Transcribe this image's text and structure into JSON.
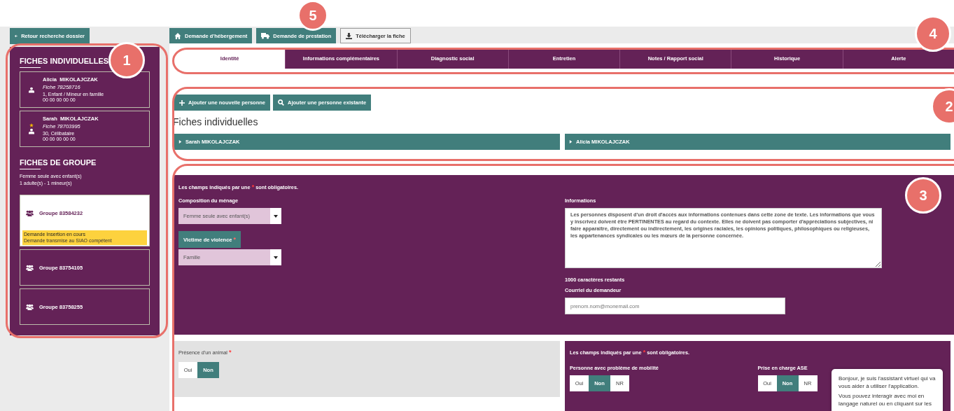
{
  "toolbar": {
    "back_button": {
      "label": "Retour recherche dossier"
    },
    "actions": [
      {
        "label": "Demande d'hébergement",
        "kind": "primary"
      },
      {
        "label": "Demande de prestation",
        "kind": "primary"
      },
      {
        "label": "Télécharger la fiche",
        "kind": "secondary"
      }
    ]
  },
  "sidebar": {
    "individual_title": "FICHES INDIVIDUELLES",
    "individuals": [
      {
        "first_name": "Alicia",
        "last_name": "MIKOLAJCZAK",
        "fiche": "Fiche 78258716",
        "detail": "1, Enfant / Mineur en famille",
        "phone": "00 00 00 00 00",
        "referent": false
      },
      {
        "first_name": "Sarah",
        "last_name": "MIKOLAJCZAK",
        "fiche": "Fiche 78703995",
        "detail": "30, Célibataire",
        "phone": "00 00 00 00 00",
        "referent": true
      }
    ],
    "group_title": "FICHES DE GROUPE",
    "group_composition": "Femme seule avec enfant(s)",
    "group_counts": "1 adulte(s) - 1 mineur(s)",
    "groups": [
      {
        "label": "Groupe 83584232",
        "selected": true,
        "status": [
          "Demande Insertion en cours",
          "Demande transmise au SIAO compétent"
        ]
      },
      {
        "label": "Groupe 83754105",
        "selected": false
      },
      {
        "label": "Groupe 83758255",
        "selected": false
      }
    ]
  },
  "tabs": [
    {
      "label": "Identité",
      "selected": true
    },
    {
      "label": "Informations complémentaires",
      "selected": false
    },
    {
      "label": "Diagnostic social",
      "selected": false
    },
    {
      "label": "Entretien",
      "selected": false
    },
    {
      "label": "Notes / Rapport social",
      "selected": false
    },
    {
      "label": "Historique",
      "selected": false
    },
    {
      "label": "Alerte",
      "selected": false
    }
  ],
  "person_buttons": [
    {
      "label": "Ajouter une nouvelle personne"
    },
    {
      "label": "Ajouter une personne existante"
    }
  ],
  "section_title": "Fiches individuelles",
  "persons": [
    {
      "label": "Sarah MIKOLAJCZAK",
      "expanded": false
    },
    {
      "label": "Alicia MIKOLAJCZAK",
      "expanded": false
    }
  ],
  "form": {
    "required_note": {
      "before": "Les champs indiqués par une",
      "mark": "*",
      "after": "sont obligatoires."
    },
    "composition": {
      "label": "Composition du ménage",
      "value": "Femme seule avec enfant(s)"
    },
    "violence": {
      "label": "Victime de violence",
      "mark": "*",
      "value": "Famille"
    },
    "informations": {
      "label": "Informations",
      "value": "Les personnes disposent d'un droit d'accès aux informations contenues dans cette zone de texte. Les informations que vous y inscrivez doivent être PERTINENTES au regard du contexte. Elles ne doivent pas comporter d'appréciations subjectives, ni faire apparaître, directement ou indirectement, les origines raciales, les opinions politiques, philosophiques ou religieuses, les appartenances syndicales ou les mœurs de la personne concernée.",
      "counter": "1000 caractères restants"
    },
    "email": {
      "label": "Courriel du demandeur",
      "placeholder": "prenom.nom@monemail.com"
    }
  },
  "animal": {
    "label": "Présence d'un animal",
    "mark": "*",
    "options": [
      {
        "label": "Oui",
        "selected": false
      },
      {
        "label": "Non",
        "selected": true
      }
    ]
  },
  "extra": {
    "required_note": {
      "before": "Les champs indiqués par une",
      "mark": "*",
      "after": "sont obligatoires."
    },
    "questions": [
      {
        "label": "Personne avec problème de mobilité",
        "options": [
          {
            "label": "Oui",
            "selected": false
          },
          {
            "label": "Non",
            "selected": true
          },
          {
            "label": "NR",
            "selected": false
          }
        ]
      },
      {
        "label": "Prise en charge ASE",
        "options": [
          {
            "label": "Oui",
            "selected": false
          },
          {
            "label": "Non",
            "selected": true
          },
          {
            "label": "NR",
            "selected": false
          }
        ]
      }
    ]
  },
  "chat": {
    "paragraphs": [
      "Bonjour, je suis l'assistant virtuel qui va vous aider à utiliser l'application.",
      "Vous pouvez interagir avec moi en langage naturel ou en cliquant sur les"
    ]
  },
  "annotations": [
    {
      "number": "1"
    },
    {
      "number": "5"
    },
    {
      "number": "4"
    },
    {
      "number": "2"
    },
    {
      "number": "3"
    }
  ]
}
